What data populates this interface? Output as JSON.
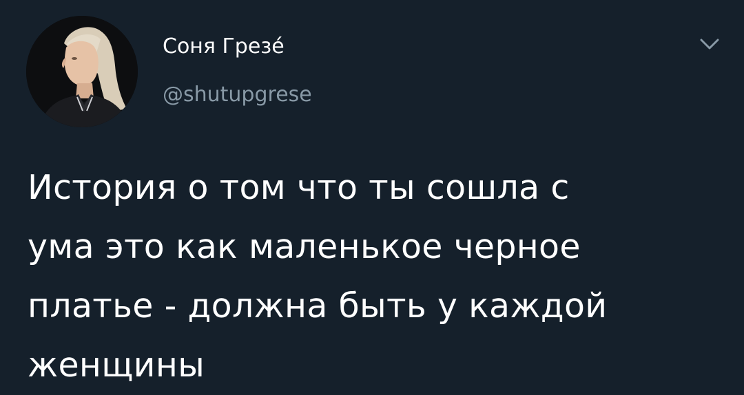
{
  "tweet": {
    "author": {
      "name": "Соня Грезе́",
      "handle": "@shutupgrese"
    },
    "text_lines": [
      "История о том что ты сошла с",
      "ума это как маленькое черное",
      "платье - должна быть у каждой",
      "женщины"
    ],
    "menu_icon": "chevron-down-icon",
    "avatar_icon": "profile-photo"
  },
  "colors": {
    "background": "#15202b",
    "primary_text": "#ffffff",
    "secondary_text": "#8899a6"
  }
}
